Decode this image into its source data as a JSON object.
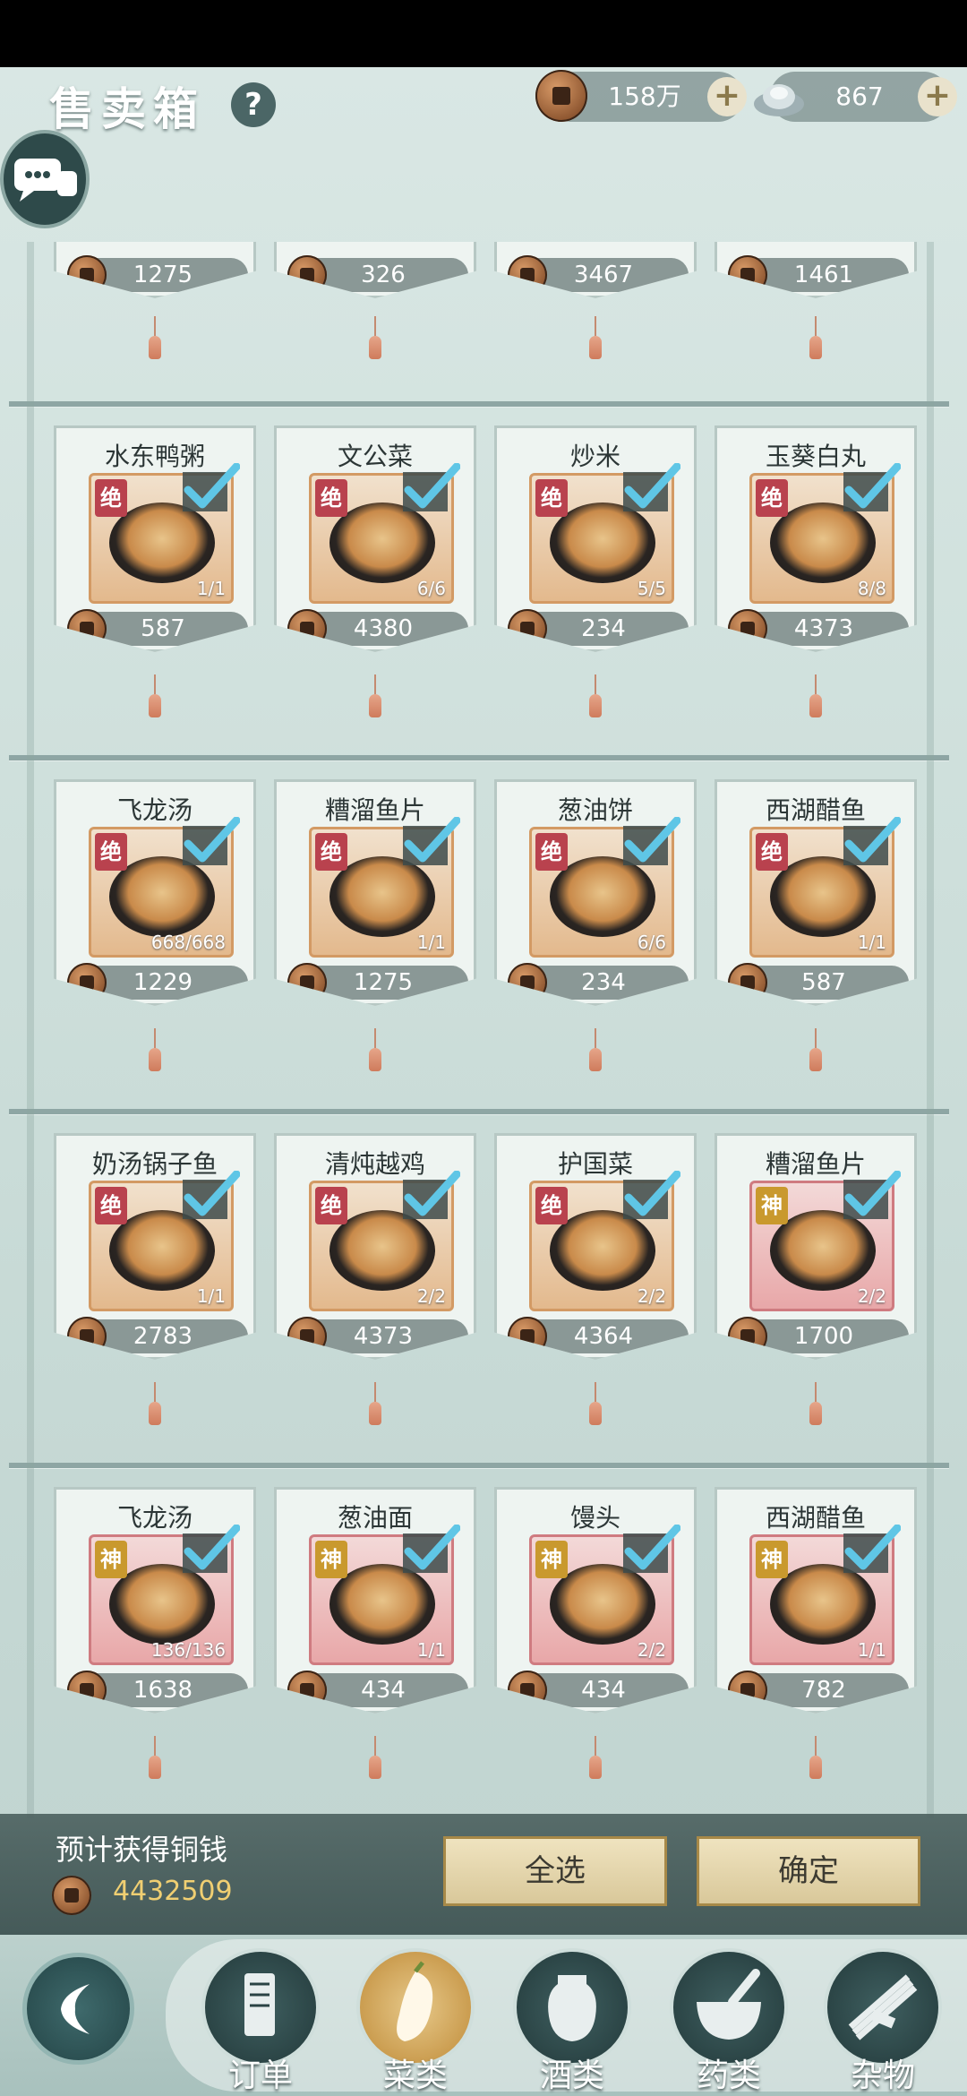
{
  "header": {
    "title": "售卖箱",
    "help_label": "?",
    "coins": "158万",
    "silver": "867",
    "plus_label": "+"
  },
  "top_row_prices": [
    "1275",
    "326",
    "3467",
    "1461"
  ],
  "dishes": [
    {
      "name": "水东鸭粥",
      "badge": "绝",
      "tier": "jue",
      "count": "1/1",
      "price": "587"
    },
    {
      "name": "文公菜",
      "badge": "绝",
      "tier": "jue",
      "count": "6/6",
      "price": "4380"
    },
    {
      "name": "炒米",
      "badge": "绝",
      "tier": "jue",
      "count": "5/5",
      "price": "234"
    },
    {
      "name": "玉葵白丸",
      "badge": "绝",
      "tier": "jue",
      "count": "8/8",
      "price": "4373"
    },
    {
      "name": "飞龙汤",
      "badge": "绝",
      "tier": "jue",
      "count": "668/668",
      "price": "1229"
    },
    {
      "name": "糟溜鱼片",
      "badge": "绝",
      "tier": "jue",
      "count": "1/1",
      "price": "1275"
    },
    {
      "name": "葱油饼",
      "badge": "绝",
      "tier": "jue",
      "count": "6/6",
      "price": "234"
    },
    {
      "name": "西湖醋鱼",
      "badge": "绝",
      "tier": "jue",
      "count": "1/1",
      "price": "587"
    },
    {
      "name": "奶汤锅子鱼",
      "badge": "绝",
      "tier": "jue",
      "count": "1/1",
      "price": "2783"
    },
    {
      "name": "清炖越鸡",
      "badge": "绝",
      "tier": "jue",
      "count": "2/2",
      "price": "4373"
    },
    {
      "name": "护国菜",
      "badge": "绝",
      "tier": "jue",
      "count": "2/2",
      "price": "4364"
    },
    {
      "name": "糟溜鱼片",
      "badge": "神",
      "tier": "shen",
      "count": "2/2",
      "price": "1700"
    },
    {
      "name": "飞龙汤",
      "badge": "神",
      "tier": "shen",
      "count": "136/136",
      "price": "1638"
    },
    {
      "name": "葱油面",
      "badge": "神",
      "tier": "shen",
      "count": "1/1",
      "price": "434"
    },
    {
      "name": "馒头",
      "badge": "神",
      "tier": "shen",
      "count": "2/2",
      "price": "434"
    },
    {
      "name": "西湖醋鱼",
      "badge": "神",
      "tier": "shen",
      "count": "1/1",
      "price": "782"
    }
  ],
  "summary": {
    "label": "预计获得铜钱",
    "value": "4432509",
    "select_all": "全选",
    "confirm": "确定"
  },
  "tabs": [
    {
      "label": "订单",
      "icon": "order-scroll-icon",
      "active": false
    },
    {
      "label": "菜类",
      "icon": "eggplant-icon",
      "active": true
    },
    {
      "label": "酒类",
      "icon": "wine-jar-icon",
      "active": false
    },
    {
      "label": "药类",
      "icon": "mortar-icon",
      "active": false
    },
    {
      "label": "杂物",
      "icon": "bundle-icon",
      "active": false
    }
  ],
  "colors": {
    "jue_badge": "#b9424e",
    "shen_badge": "#c9992e",
    "check": "#5fc6e6",
    "coin_text": "#f0cf72"
  }
}
